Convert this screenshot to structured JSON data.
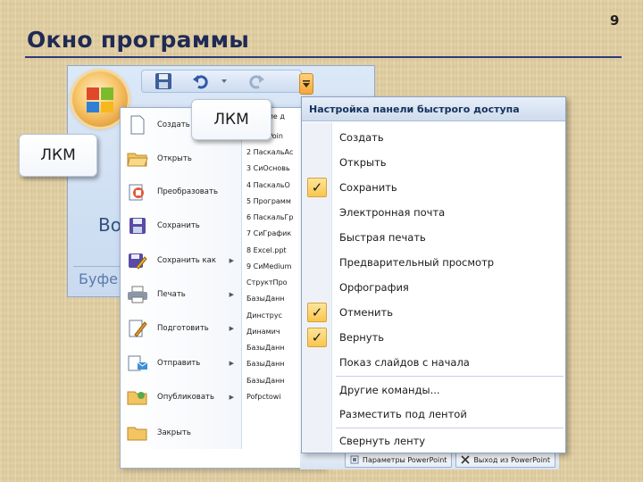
{
  "slide": {
    "title": "Окно программы",
    "page_number": "9"
  },
  "background_window": {
    "ribbon_text": "Во",
    "group_label": "Буфе"
  },
  "office_menu": {
    "items": [
      {
        "label": "Создать",
        "icon": "new-document-icon",
        "arrow": false
      },
      {
        "label": "Открыть",
        "icon": "open-folder-icon",
        "arrow": false
      },
      {
        "label": "Преобразовать",
        "icon": "convert-icon",
        "arrow": false
      },
      {
        "label": "Сохранить",
        "icon": "save-disk-icon",
        "arrow": false
      },
      {
        "label": "Сохранить как",
        "icon": "save-as-icon",
        "arrow": true
      },
      {
        "label": "Печать",
        "icon": "printer-icon",
        "arrow": true
      },
      {
        "label": "Подготовить",
        "icon": "prepare-icon",
        "arrow": true
      },
      {
        "label": "Отправить",
        "icon": "send-icon",
        "arrow": true
      },
      {
        "label": "Опубликовать",
        "icon": "publish-icon",
        "arrow": true
      },
      {
        "label": "Закрыть",
        "icon": "close-folder-icon",
        "arrow": false
      }
    ],
    "recent_documents": [
      "Учебние д",
      "PowerPoin",
      "2 ПаскальАс",
      "3 СиОсновь",
      "4 ПаскальО",
      "5 Программ",
      "6 ПаскальГр",
      "7 СиГрафик",
      "8 Excel.ppt",
      "9 СиMedium",
      "СтруктПро",
      "БазыДанн",
      "Динструс",
      "Динамич",
      "БазыДанн",
      "БазыДанн",
      "БазыДанн",
      "Pofpctowi"
    ],
    "footer_buttons": [
      {
        "label": "Параметры PowerPoint",
        "icon": "options-icon"
      },
      {
        "label": "Выход из PowerPoint",
        "icon": "exit-x-icon"
      }
    ]
  },
  "qat_menu": {
    "header": "Настройка панели быстрого доступа",
    "items": [
      {
        "label": "Создать",
        "checked": false
      },
      {
        "label": "Открыть",
        "checked": false
      },
      {
        "label": "Сохранить",
        "checked": true
      },
      {
        "label": "Электронная почта",
        "checked": false
      },
      {
        "label": "Быстрая печать",
        "checked": false
      },
      {
        "label": "Предварительный просмотр",
        "checked": false
      },
      {
        "label": "Орфография",
        "checked": false
      },
      {
        "label": "Отменить",
        "checked": true
      },
      {
        "label": "Вернуть",
        "checked": true
      },
      {
        "label": "Показ слайдов с начала",
        "checked": false
      },
      {
        "label": "Другие команды...",
        "checked": false
      },
      {
        "label": "Разместить под лентой",
        "checked": false
      },
      {
        "label": "Свернуть ленту",
        "checked": false
      }
    ],
    "check_glyph": "✓"
  },
  "callouts": {
    "left": "ЛКМ",
    "top": "ЛКМ"
  },
  "colors": {
    "background": "#e3cfa0",
    "title": "#1f2a55",
    "check_highlight": "#f9c64d"
  }
}
